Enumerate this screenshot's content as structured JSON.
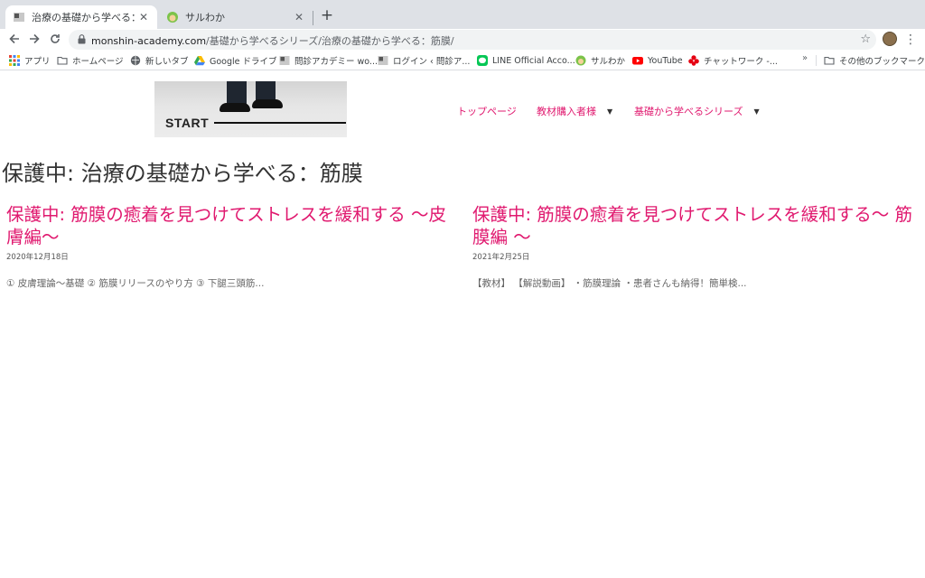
{
  "browser": {
    "tabs": [
      {
        "title": "治療の基礎から学べる：筋膜 – 問",
        "active": true
      },
      {
        "title": "サルわか",
        "active": false
      }
    ],
    "close_glyph": "✕",
    "new_tab_glyph": "+",
    "url": {
      "domain": "monshin-academy.com",
      "path": "/基礎から学べるシリーズ/治療の基礎から学べる：筋膜/"
    },
    "bookmarks": [
      {
        "label": "アプリ",
        "icon": "apps-grid-icon"
      },
      {
        "label": "ホームページ",
        "icon": "folder-icon"
      },
      {
        "label": "新しいタブ",
        "icon": "globe-icon"
      },
      {
        "label": "Google ドライブ",
        "icon": "google-drive-icon"
      },
      {
        "label": "問診アカデミー wo...",
        "icon": "site-favicon"
      },
      {
        "label": "ログイン ‹ 問診ア...",
        "icon": "site-favicon"
      },
      {
        "label": "LINE Official Acco...",
        "icon": "line-icon"
      },
      {
        "label": "サルわか",
        "icon": "monkey-icon"
      },
      {
        "label": "YouTube",
        "icon": "youtube-icon"
      },
      {
        "label": "チャットワーク -...",
        "icon": "chatwork-icon"
      }
    ],
    "bookmarks_more": "»",
    "other_bookmarks": "その他のブックマーク"
  },
  "site": {
    "hero_text": "START",
    "nav": [
      {
        "label": "トップページ",
        "has_dropdown": false
      },
      {
        "label": "教材購入者様",
        "has_dropdown": true
      },
      {
        "label": "基礎から学べるシリーズ",
        "has_dropdown": true
      }
    ],
    "caret": "▼",
    "page_title": "保護中: 治療の基礎から学べる：筋膜",
    "posts": [
      {
        "title": "保護中: 筋膜の癒着を見つけてストレスを緩和する 〜皮膚編〜",
        "date": "2020年12月18日",
        "excerpt": "① 皮膚理論〜基礎 ② 筋膜リリースのやり方 ③ 下腿三頭筋..."
      },
      {
        "title": "保護中: 筋膜の癒着を見つけてストレスを緩和する〜 筋膜編 〜",
        "date": "2021年2月25日",
        "excerpt": "【教材】 【解説動画】 ・筋膜理論 ・患者さんも納得！簡単検..."
      }
    ]
  },
  "colors": {
    "accent": "#e0196f",
    "title_text": "#333333",
    "tabstrip_bg": "#dee1e6"
  }
}
